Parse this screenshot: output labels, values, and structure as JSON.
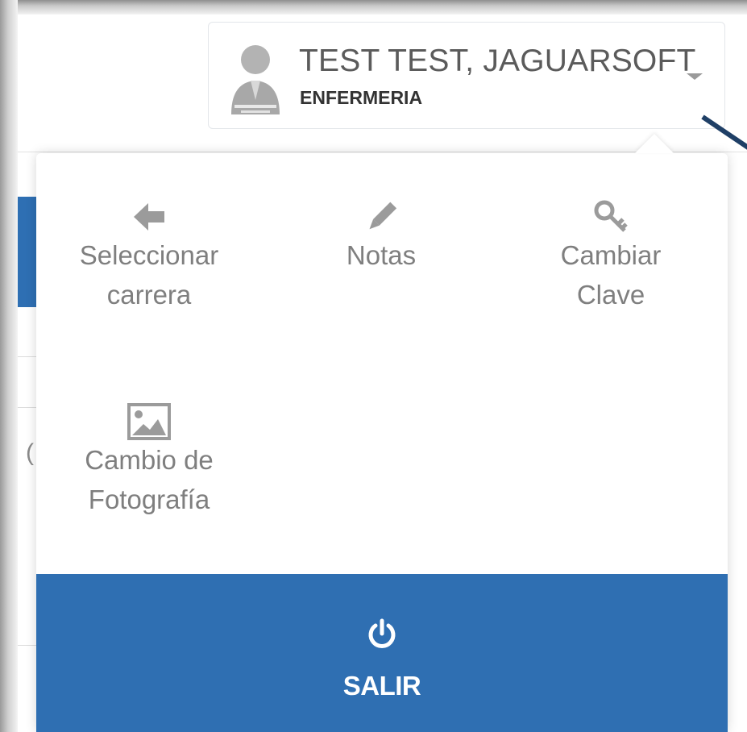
{
  "user": {
    "name": "TEST TEST, JAGUARSOFT",
    "role": "ENFERMERIA",
    "avatar_icon": "user-avatar-icon",
    "caret_icon": "caret-down-icon"
  },
  "menu": {
    "items": [
      {
        "line1": "Seleccionar",
        "line2": "carrera",
        "icon": "arrow-left-icon"
      },
      {
        "line1": "Notas",
        "line2": "",
        "icon": "pencil-icon"
      },
      {
        "line1": "Cambiar",
        "line2": "Clave",
        "icon": "key-icon"
      },
      {
        "line1": "Cambio de",
        "line2": "Fotografía",
        "icon": "image-icon"
      }
    ],
    "logout": {
      "label": "SALIR",
      "icon": "power-icon"
    }
  },
  "colors": {
    "accent": "#2f6fb2",
    "label_gray": "#7f7f7f",
    "icon_gray": "#9b9b9b"
  }
}
